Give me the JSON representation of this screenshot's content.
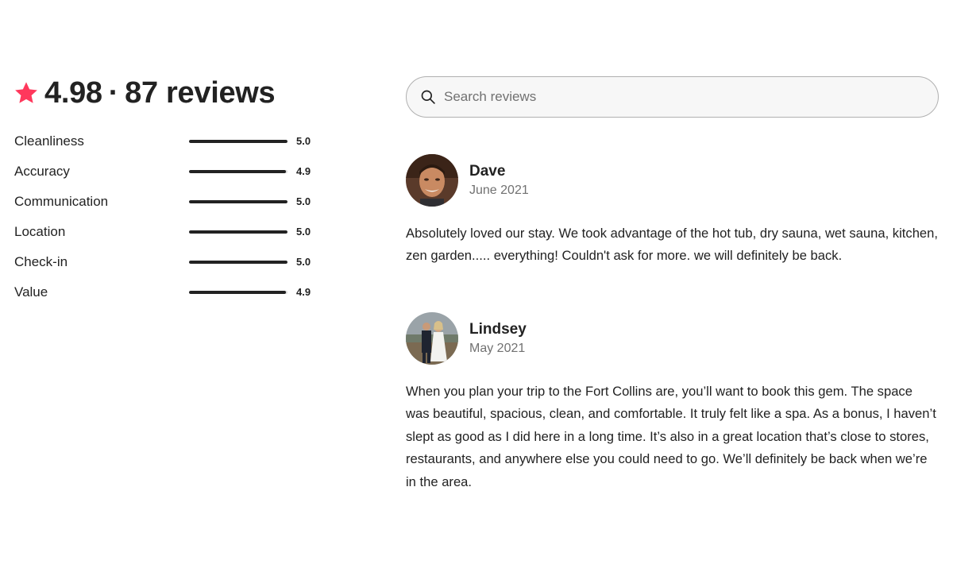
{
  "summary": {
    "rating": "4.98",
    "separator": "·",
    "reviews_count": "87 reviews",
    "accent_color": "#FF385C"
  },
  "ratings": [
    {
      "label": "Cleanliness",
      "value": "5.0",
      "fraction": 1.0
    },
    {
      "label": "Accuracy",
      "value": "4.9",
      "fraction": 0.98
    },
    {
      "label": "Communication",
      "value": "5.0",
      "fraction": 1.0
    },
    {
      "label": "Location",
      "value": "5.0",
      "fraction": 1.0
    },
    {
      "label": "Check-in",
      "value": "5.0",
      "fraction": 1.0
    },
    {
      "label": "Value",
      "value": "4.9",
      "fraction": 0.98
    }
  ],
  "search": {
    "placeholder": "Search reviews",
    "value": "",
    "icon": "search-icon"
  },
  "reviews": [
    {
      "name": "Dave",
      "date": "June 2021",
      "text": "Absolutely loved our stay. We took advantage of the hot tub, dry sauna, wet sauna, kitchen, zen garden..... everything! Couldn't ask for more. we will definitely be back."
    },
    {
      "name": "Lindsey",
      "date": "May 2021",
      "text": "When you plan your trip to the Fort Collins are, you’ll want to book this gem. The space was beautiful, spacious, clean, and comfortable. It truly felt like a spa. As a bonus, I haven’t slept as good as I did here in a long time. It’s also in a great location that’s close to stores, restaurants, and anywhere else you could need to go. We’ll definitely be back when we’re in the area."
    }
  ]
}
